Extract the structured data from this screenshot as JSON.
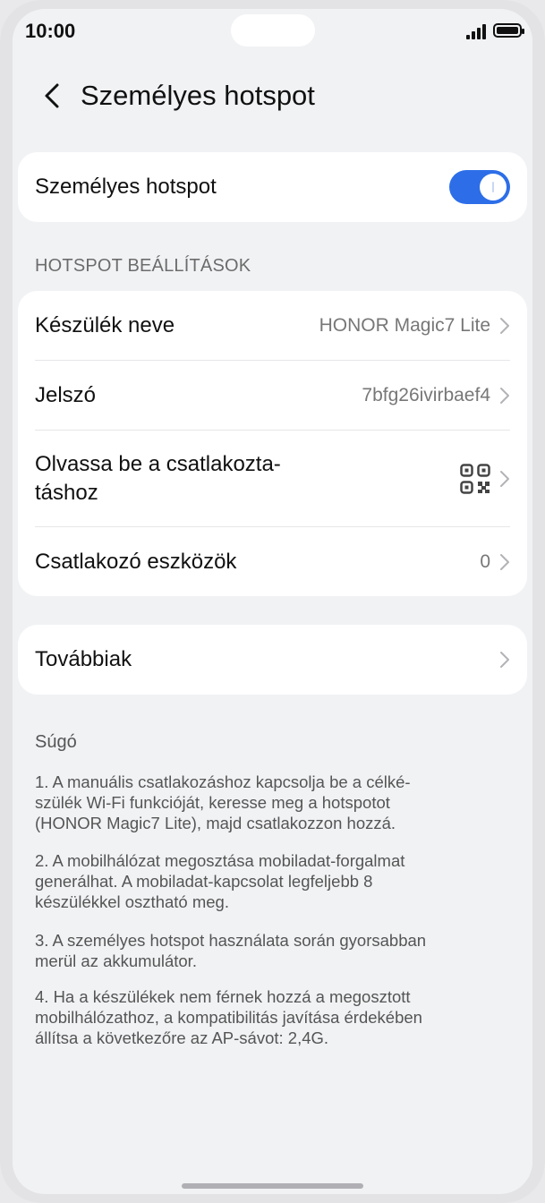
{
  "status_bar": {
    "time": "10:00"
  },
  "header": {
    "title": "Személyes hotspot"
  },
  "hotspot_toggle": {
    "label": "Személyes hotspot",
    "on": true
  },
  "section": {
    "title": "HOTSPOT BEÁLLÍTÁSOK"
  },
  "settings": {
    "device_name_label": "Készülék neve",
    "device_name_value": "HONOR Magic7 Lite",
    "password_label": "Jelszó",
    "password_value": "7bfg26ivirbaef4",
    "scan_label_line1": "Olvassa be a csatlakozta-",
    "scan_label_line2": "táshoz",
    "connected_label": "Csatlakozó eszközök",
    "connected_value": "0"
  },
  "more": {
    "label": "Továbbiak"
  },
  "help": {
    "title": "Súgó",
    "p1_l1": "1. A manuális csatlakozáshoz kapcsolja be a célké-",
    "p1_l2": "szülék Wi-Fi funkcióját, keresse meg a hotspotot",
    "p1_l3": "(HONOR Magic7 Lite), majd csatlakozzon hozzá.",
    "p2_l1": "2. A mobilhálózat megosztása mobiladat-forgalmat",
    "p2_l2": "generálhat. A mobiladat-kapcsolat legfeljebb 8",
    "p2_l3": "készülékkel osztható meg.",
    "p3_l1": "3. A személyes hotspot használata során gyorsabban",
    "p3_l2": "merül az akkumulátor.",
    "p4_l1": "4. Ha a készülékek nem férnek hozzá a megosztott",
    "p4_l2": "mobilhálózathoz, a kompatibilitás javítása érdekében",
    "p4_l3": "állítsa a következőre az AP-sávot: 2,4G."
  },
  "colors": {
    "accent": "#2d6ee8",
    "background": "#f1f2f4",
    "card": "#ffffff"
  },
  "icons": [
    "chevron-left-icon",
    "chevron-right-icon",
    "qr-code-icon",
    "signal-icon",
    "battery-icon"
  ]
}
